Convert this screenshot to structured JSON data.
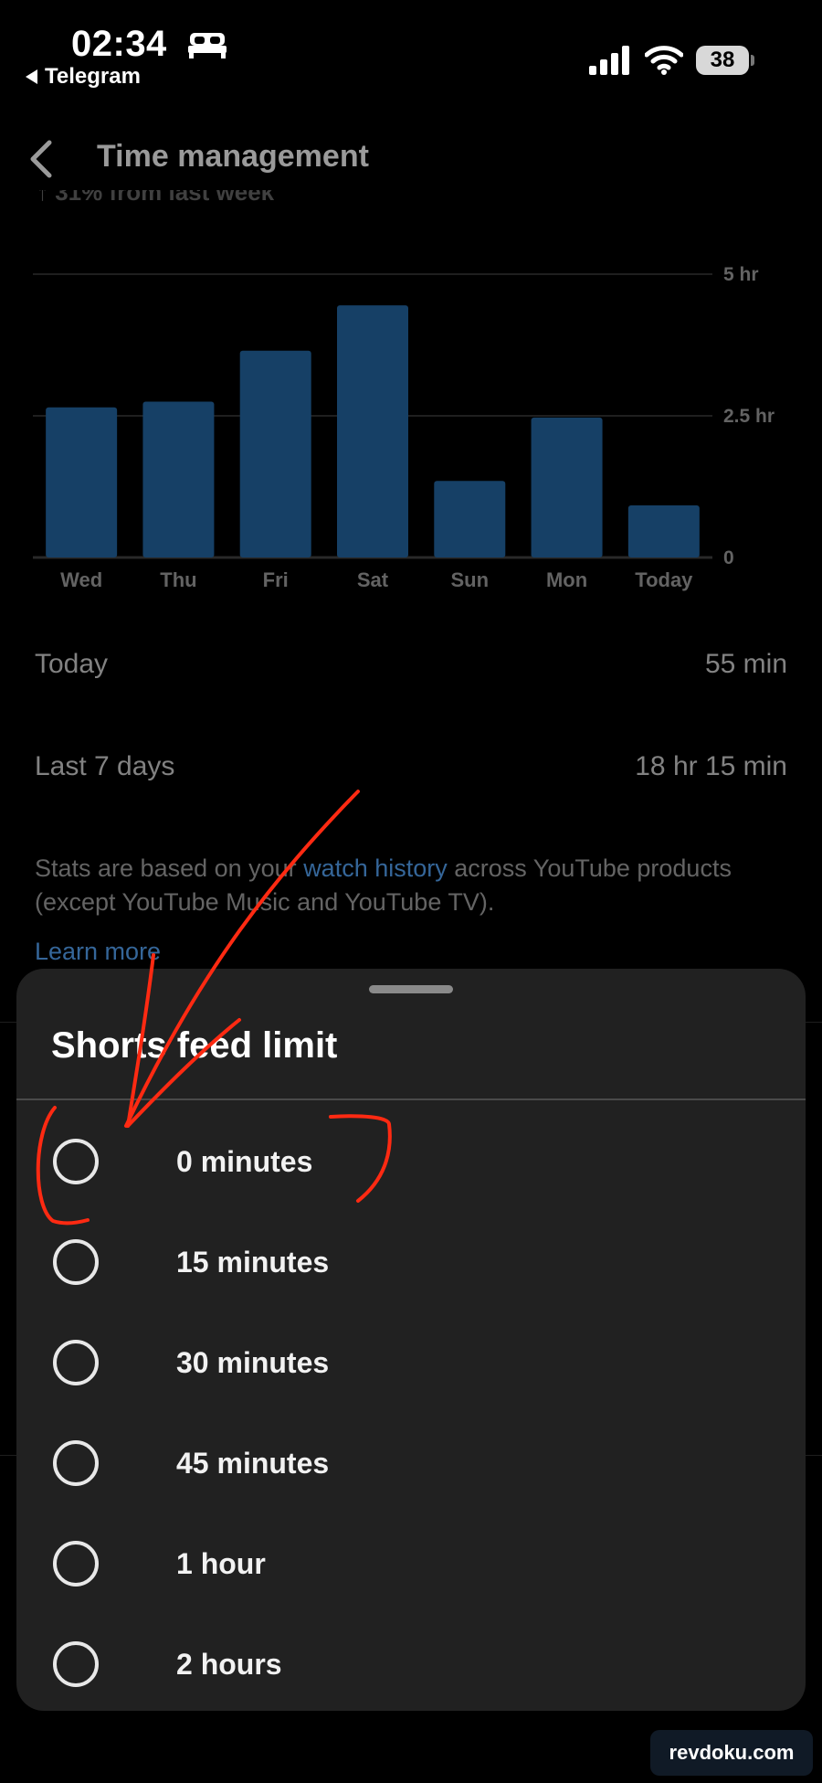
{
  "status_bar": {
    "time": "02:34",
    "back_app": "Telegram",
    "battery": "38"
  },
  "header": {
    "title": "Time management"
  },
  "partial_text": "↑ 31% from last week",
  "chart_data": {
    "type": "bar",
    "categories": [
      "Wed",
      "Thu",
      "Fri",
      "Sat",
      "Sun",
      "Mon",
      "Today"
    ],
    "values": [
      2.65,
      2.75,
      3.65,
      4.45,
      1.35,
      2.47,
      0.92
    ],
    "ylim": [
      0,
      5
    ],
    "yticks": [
      {
        "value": 5,
        "label": "5 hr"
      },
      {
        "value": 2.5,
        "label": "2.5 hr"
      },
      {
        "value": 0,
        "label": "0"
      }
    ],
    "bar_color": "#1f5a8f",
    "grid": true
  },
  "stats": {
    "today_label": "Today",
    "today_value": "55 min",
    "week_label": "Last 7 days",
    "week_value": "18 hr 15 min"
  },
  "disclaimer": {
    "before": "Stats are based on your ",
    "link": "watch history",
    "after": " across YouTube products (except YouTube Music and YouTube TV).",
    "learn_more": "Learn more"
  },
  "sheet": {
    "title": "Shorts feed limit",
    "options": [
      {
        "label": "0 minutes"
      },
      {
        "label": "15 minutes"
      },
      {
        "label": "30 minutes"
      },
      {
        "label": "45 minutes"
      },
      {
        "label": "1 hour"
      },
      {
        "label": "2 hours"
      }
    ]
  },
  "annotation_color": "#ff2a12",
  "watermark": "revdoku.com"
}
